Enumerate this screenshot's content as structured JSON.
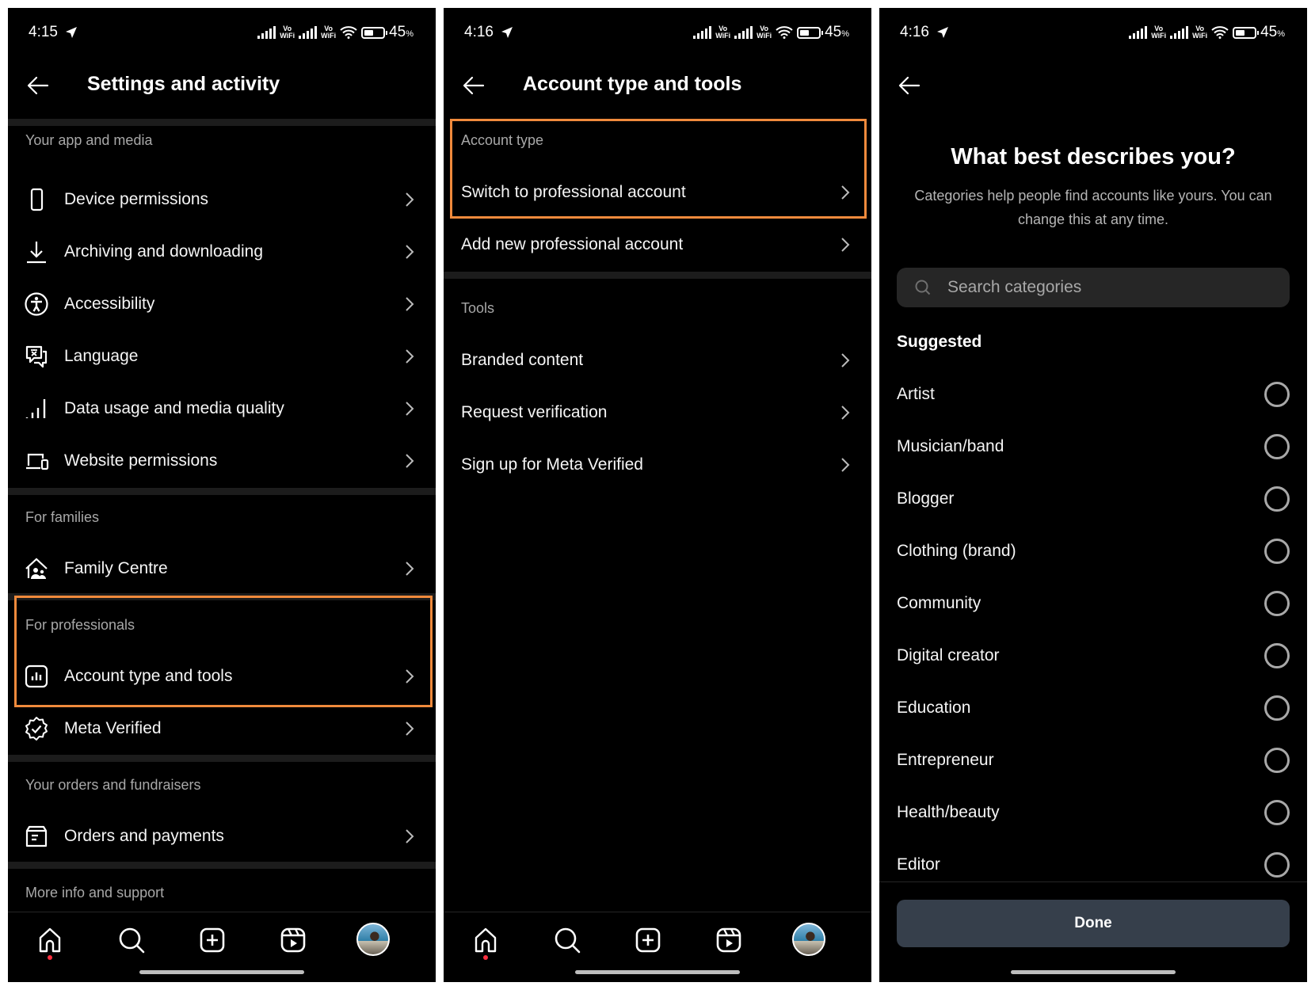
{
  "colors": {
    "background": "#000000",
    "highlight": "#f08a3c",
    "section_label": "#a8a8a8",
    "done_button": "#363f4b",
    "notification_dot": "#ff3040"
  },
  "screens": [
    {
      "status": {
        "time": "4:15",
        "vo1": "Vo",
        "wifi1": "WiFi",
        "vo2": "Vo",
        "wifi2": "WiFi",
        "battery_percent": "45",
        "battery_unit": "%"
      },
      "title": "Settings and activity",
      "sections": [
        {
          "label": "Your app and media",
          "items": [
            {
              "label": "Device permissions",
              "icon": "phone-icon"
            },
            {
              "label": "Archiving and downloading",
              "icon": "download-icon"
            },
            {
              "label": "Accessibility",
              "icon": "accessibility-icon"
            },
            {
              "label": "Language",
              "icon": "language-icon"
            },
            {
              "label": "Data usage and media quality",
              "icon": "signal-bars-icon"
            },
            {
              "label": "Website permissions",
              "icon": "devices-icon"
            }
          ]
        },
        {
          "label": "For families",
          "items": [
            {
              "label": "Family Centre",
              "icon": "family-home-icon"
            }
          ]
        },
        {
          "label": "For professionals",
          "highlighted": true,
          "items": [
            {
              "label": "Account type and tools",
              "icon": "insights-icon"
            },
            {
              "label": "Meta Verified",
              "icon": "verified-badge-icon"
            }
          ]
        },
        {
          "label": "Your orders and fundraisers",
          "items": [
            {
              "label": "Orders and payments",
              "icon": "orders-icon"
            }
          ]
        },
        {
          "label": "More info and support",
          "items": []
        }
      ],
      "bottom_nav": [
        "home",
        "search",
        "create",
        "reels",
        "profile"
      ]
    },
    {
      "status": {
        "time": "4:16",
        "vo1": "Vo",
        "wifi1": "WiFi",
        "vo2": "Vo",
        "wifi2": "WiFi",
        "battery_percent": "45",
        "battery_unit": "%"
      },
      "title": "Account type and tools",
      "sections": [
        {
          "label": "Account type",
          "highlighted": true,
          "items": [
            {
              "label": "Switch to professional account"
            },
            {
              "label": "Add new professional account"
            }
          ]
        },
        {
          "label": "Tools",
          "items": [
            {
              "label": "Branded content"
            },
            {
              "label": "Request verification"
            },
            {
              "label": "Sign up for Meta Verified"
            }
          ]
        }
      ],
      "bottom_nav": [
        "home",
        "search",
        "create",
        "reels",
        "profile"
      ]
    },
    {
      "status": {
        "time": "4:16",
        "vo1": "Vo",
        "wifi1": "WiFi",
        "vo2": "Vo",
        "wifi2": "WiFi",
        "battery_percent": "45",
        "battery_unit": "%"
      },
      "heading": "What best describes you?",
      "subtitle": "Categories help people find accounts like yours. You can change this at any time.",
      "search_placeholder": "Search categories",
      "search_value": "",
      "suggested_label": "Suggested",
      "categories": [
        {
          "label": "Artist",
          "selected": false
        },
        {
          "label": "Musician/band",
          "selected": false
        },
        {
          "label": "Blogger",
          "selected": false
        },
        {
          "label": "Clothing (brand)",
          "selected": false
        },
        {
          "label": "Community",
          "selected": false
        },
        {
          "label": "Digital creator",
          "selected": false
        },
        {
          "label": "Education",
          "selected": false
        },
        {
          "label": "Entrepreneur",
          "selected": false
        },
        {
          "label": "Health/beauty",
          "selected": false
        },
        {
          "label": "Editor",
          "selected": false
        }
      ],
      "done_label": "Done"
    }
  ]
}
